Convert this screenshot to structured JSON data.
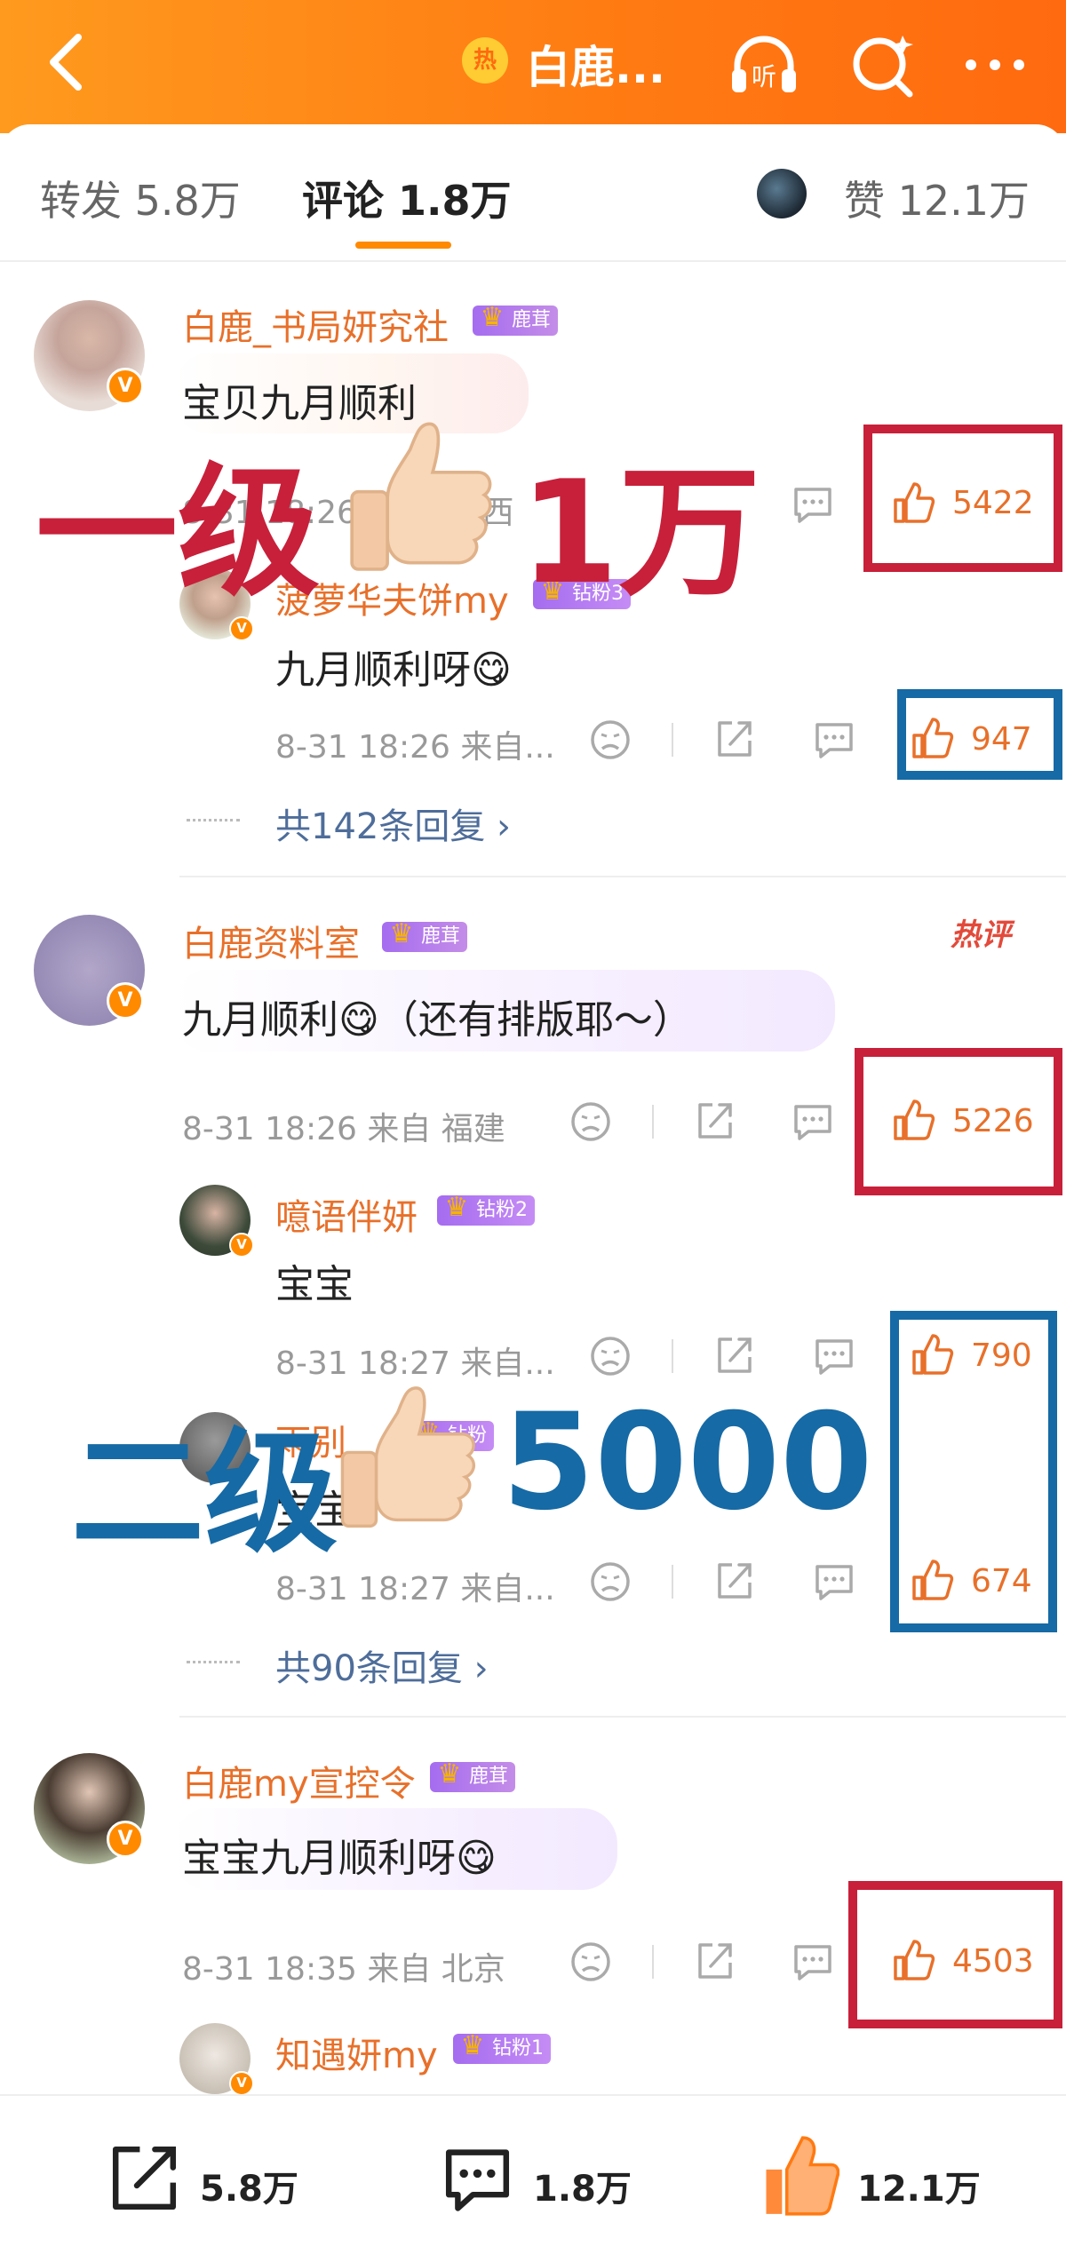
{
  "header": {
    "title": "白鹿...",
    "hot_badge": "热",
    "accent": "#ff7a12"
  },
  "tabs": {
    "repost": "转发 5.8万",
    "comments": "评论 1.8万",
    "likes": "赞 12.1万"
  },
  "comments": [
    {
      "user": "白鹿_书局妍究社",
      "tag": "鹿茸",
      "text": "宝贝九月顺利",
      "meta": "8-31 18:26 来自 ... 西",
      "likes": "5422",
      "replies": [
        {
          "user": "菠萝华夫饼my",
          "tag": "钻粉3",
          "text": "九月顺利呀😋",
          "meta": "8-31 18:26  来自...",
          "likes": "947"
        }
      ],
      "more_replies": "共142条回复 ›"
    },
    {
      "user": "白鹿资料室",
      "tag": "鹿茸",
      "text": "九月顺利😋（还有排版耶～）",
      "meta": "8-31 18:26  来自 福建",
      "likes": "5226",
      "hot_label": "热评",
      "replies": [
        {
          "user": "噫语伴妍",
          "tag": "钻粉2",
          "text": "宝宝",
          "meta": "8-31 18:27  来自...",
          "likes": "790"
        },
        {
          "user": "雨别",
          "tag": "钻粉",
          "text": "宝宝",
          "meta": "8-31 18:27  来自...",
          "likes": "674"
        }
      ],
      "more_replies": "共90条回复 ›"
    },
    {
      "user": "白鹿my宣控令",
      "tag": "鹿茸",
      "text": "宝宝九月顺利呀😋",
      "meta": "8-31 18:35  来自 北京",
      "likes": "4503",
      "replies": [
        {
          "user": "知遇妍my",
          "tag": "钻粉1"
        }
      ]
    }
  ],
  "annotations": {
    "level1": "一级",
    "level1_value": "1万",
    "level2": "二级",
    "level2_value": "5000",
    "red": "#c8203a",
    "blue": "#166aa5"
  },
  "bottom_bar": {
    "repost": "5.8万",
    "comments": "1.8万",
    "likes": "12.1万"
  },
  "icons": [
    "back-icon",
    "headphone-icon",
    "search-icon",
    "more-icon",
    "dislike-icon",
    "share-icon",
    "comment-icon",
    "thumbs-up-icon"
  ]
}
